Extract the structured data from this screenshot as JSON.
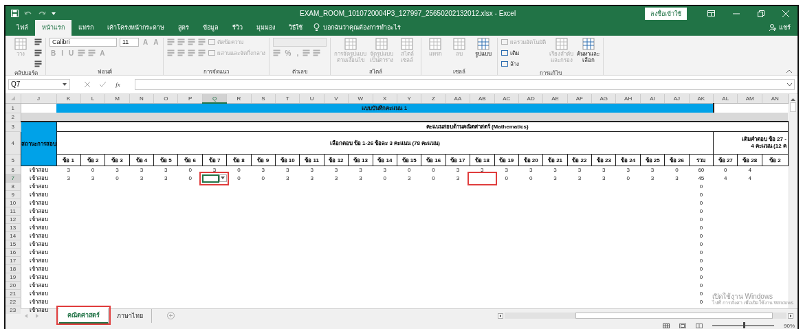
{
  "title_bar": {
    "title": "EXAM_ROOM_1010720004P3_127997_25650202132012.xlsx  -  Excel",
    "sign_in": "ลงชื่อเข้าใช้"
  },
  "ribbon_tabs": [
    {
      "label": "ไฟล์",
      "selected": false
    },
    {
      "label": "หน้าแรก",
      "selected": true
    },
    {
      "label": "แทรก",
      "selected": false
    },
    {
      "label": "เค้าโครงหน้ากระดาษ",
      "selected": false
    },
    {
      "label": "สูตร",
      "selected": false
    },
    {
      "label": "ข้อมูล",
      "selected": false
    },
    {
      "label": "รีวิว",
      "selected": false
    },
    {
      "label": "มุมมอง",
      "selected": false
    },
    {
      "label": "วิธีใช้",
      "selected": false
    }
  ],
  "tell_me": {
    "placeholder": "บอกฉันว่าคุณต้องการทำอะไร"
  },
  "share": "แชร์",
  "ribbon_groups": [
    {
      "label": "คลิปบอร์ด",
      "parts": [
        {
          "kind": "large",
          "items": [
            {
              "kind": "large",
              "label": "วาง",
              "disabled": true
            }
          ]
        },
        {
          "kind": "lines",
          "items": [
            [
              {
                "kind": "icon",
                "disabled": false
              }
            ],
            [
              {
                "kind": "icon",
                "disabled": false
              }
            ],
            [
              {
                "kind": "icon",
                "disabled": false
              }
            ]
          ]
        }
      ]
    },
    {
      "label": "ฟอนต์",
      "parts": [
        {
          "kind": "lines",
          "items": [
            [
              {
                "kind": "field",
                "label": "Calibri",
                "disabled": false
              },
              {
                "kind": "field",
                "label": "11",
                "disabled": false
              },
              {
                "kind": "glyph",
                "label": "A",
                "disabled": true
              },
              {
                "kind": "glyph",
                "label": "A",
                "disabled": true
              }
            ],
            [
              {
                "kind": "glyph",
                "label": "B",
                "disabled": true
              },
              {
                "kind": "glyph",
                "label": "I",
                "disabled": true
              },
              {
                "kind": "glyph",
                "label": "U",
                "disabled": true
              },
              {
                "kind": "icon",
                "disabled": true
              },
              {
                "kind": "icon",
                "disabled": true
              },
              {
                "kind": "glyph",
                "label": "A",
                "disabled": true
              }
            ]
          ]
        }
      ]
    },
    {
      "label": "การจัดแนว",
      "parts": [
        {
          "kind": "lines",
          "items": [
            [
              {
                "kind": "icon",
                "disabled": true
              },
              {
                "kind": "icon",
                "disabled": true
              },
              {
                "kind": "icon",
                "disabled": true
              },
              {
                "kind": "icon",
                "disabled": true
              },
              {
                "kind": "small",
                "label": "ตัดข้อความ",
                "disabled": true
              }
            ],
            [
              {
                "kind": "icon",
                "disabled": true
              },
              {
                "kind": "icon",
                "disabled": true
              },
              {
                "kind": "icon",
                "disabled": true
              },
              {
                "kind": "icon",
                "disabled": true
              },
              {
                "kind": "small",
                "label": "ผสานและจัดกึ่งกลาง",
                "disabled": true
              }
            ]
          ]
        }
      ]
    },
    {
      "label": "ตัวเลข",
      "parts": [
        {
          "kind": "lines",
          "items": [
            [
              {
                "kind": "field",
                "disabled": true
              }
            ],
            [
              {
                "kind": "icon",
                "disabled": true
              },
              {
                "kind": "glyph",
                "label": "%",
                "disabled": true
              },
              {
                "kind": "glyph",
                "label": ",",
                "disabled": true
              },
              {
                "kind": "icon",
                "disabled": true
              },
              {
                "kind": "icon",
                "disabled": true
              }
            ]
          ]
        }
      ]
    },
    {
      "label": "สไตล์",
      "parts": [
        {
          "kind": "large",
          "items": [
            {
              "kind": "large",
              "label": "การจัดรูปแบบ\nตามเงื่อนไข",
              "disabled": true
            },
            {
              "kind": "large",
              "label": "จัดรูปแบบ\nเป็นตาราง",
              "disabled": true
            },
            {
              "kind": "large",
              "label": "สไตล์\nเซลล์",
              "disabled": true
            }
          ]
        }
      ]
    },
    {
      "label": "เซลล์",
      "parts": [
        {
          "kind": "large",
          "items": [
            {
              "kind": "large",
              "label": "แทรก",
              "disabled": true
            },
            {
              "kind": "large",
              "label": "ลบ",
              "disabled": true
            },
            {
              "kind": "large",
              "label": "รูปแบบ",
              "disabled": false
            }
          ]
        }
      ]
    },
    {
      "label": "การแก้ไข",
      "parts": [
        {
          "kind": "lines",
          "items": [
            [
              {
                "kind": "small",
                "label": "ผลรวมอัตโนมัติ",
                "disabled": true
              }
            ],
            [
              {
                "kind": "small",
                "label": "เติม",
                "disabled": false
              }
            ],
            [
              {
                "kind": "small",
                "label": "ล้าง",
                "disabled": false
              }
            ]
          ]
        },
        {
          "kind": "large",
          "items": [
            {
              "kind": "large",
              "label": "เรียงลำดับ\nและกรอง",
              "disabled": true
            },
            {
              "kind": "large",
              "label": "ค้นหาและ\nเลือก",
              "disabled": false
            }
          ]
        }
      ]
    }
  ],
  "formula_bar": {
    "name_box": "Q7",
    "function_label": "fx"
  },
  "columns": [
    {
      "label": "J",
      "selected": false
    },
    {
      "label": "K",
      "selected": false
    },
    {
      "label": "L",
      "selected": false
    },
    {
      "label": "M",
      "selected": false
    },
    {
      "label": "N",
      "selected": false
    },
    {
      "label": "O",
      "selected": false
    },
    {
      "label": "P",
      "selected": false
    },
    {
      "label": "Q",
      "selected": true
    },
    {
      "label": "R",
      "selected": false
    },
    {
      "label": "S",
      "selected": false
    },
    {
      "label": "T",
      "selected": false
    },
    {
      "label": "U",
      "selected": false
    },
    {
      "label": "V",
      "selected": false
    },
    {
      "label": "W",
      "selected": false
    },
    {
      "label": "X",
      "selected": false
    },
    {
      "label": "Y",
      "selected": false
    },
    {
      "label": "Z",
      "selected": false
    },
    {
      "label": "AA",
      "selected": false
    },
    {
      "label": "AB",
      "selected": false
    },
    {
      "label": "AC",
      "selected": false
    },
    {
      "label": "AD",
      "selected": false
    },
    {
      "label": "AE",
      "selected": false
    },
    {
      "label": "AF",
      "selected": false
    },
    {
      "label": "AG",
      "selected": false
    },
    {
      "label": "AH",
      "selected": false
    },
    {
      "label": "AI",
      "selected": false
    },
    {
      "label": "AJ",
      "selected": false
    },
    {
      "label": "AK",
      "selected": false
    },
    {
      "label": "AL",
      "selected": false
    },
    {
      "label": "AM",
      "selected": false
    },
    {
      "label": "AN",
      "selected": false
    }
  ],
  "header_rows": [
    "1",
    "2",
    "3",
    "4",
    "5"
  ],
  "sheet_header": {
    "banner": "แบบบันทึกคะแนน 1",
    "status_heading": "สถานะการสอบ",
    "section_title": "คะแนนสอบด้านคณิตศาสตร์ (Mathematics)",
    "choice_heading": "เลือกตอบ ข้อ 1-26 ข้อละ 3 คะแนน (78 คะแนน)",
    "fill_heading": [
      "เติมคำตอบ ข้อ 27 -",
      "4 คะแนน (12 ค"
    ],
    "question_labels": [
      "ข้อ 1",
      "ข้อ 2",
      "ข้อ 3",
      "ข้อ 4",
      "ข้อ 5",
      "ข้อ 6",
      "ข้อ 7",
      "ข้อ 8",
      "ข้อ 9",
      "ข้อ 10",
      "ข้อ 11",
      "ข้อ 12",
      "ข้อ 13",
      "ข้อ 14",
      "ข้อ 15",
      "ข้อ 16",
      "ข้อ 17",
      "ข้อ 18",
      "ข้อ 19",
      "ข้อ 20",
      "ข้อ 21",
      "ข้อ 22",
      "ข้อ 23",
      "ข้อ 24",
      "ข้อ 25",
      "ข้อ 26"
    ],
    "total_label": "รวม",
    "fill_labels": [
      "ข้อ 27",
      "ข้อ 28",
      "ข้อ 2"
    ]
  },
  "rows": [
    {
      "num": "6",
      "selected": false,
      "status": "เข้าสอบ",
      "scores": [
        "3",
        "0",
        "3",
        "3",
        "3",
        "0",
        "3",
        "0",
        "3",
        "3",
        "3",
        "3",
        "3",
        "3",
        "0",
        "0",
        "3",
        "3",
        "3",
        "3",
        "3",
        "3",
        "3",
        "3",
        "3",
        "0"
      ],
      "total": "60",
      "extra": [
        "0",
        "4"
      ]
    },
    {
      "num": "7",
      "selected": true,
      "status": "เข้าสอบ",
      "scores": [
        "3",
        "3",
        "0",
        "3",
        "3",
        "0",
        {
          "selected": true,
          "marked": true,
          "dropdown": true
        },
        "0",
        "0",
        "3",
        "3",
        "3",
        "3",
        "0",
        "3",
        "0",
        "3",
        {
          "marked": true
        },
        "0",
        "0",
        "3",
        "3",
        "3",
        "0",
        "3",
        "3"
      ],
      "total": "45",
      "extra": [
        "4",
        "4"
      ]
    },
    {
      "num": "8",
      "selected": false,
      "status": "เข้าสอบ",
      "total": "0"
    },
    {
      "num": "9",
      "selected": false,
      "status": "เข้าสอบ",
      "total": "0"
    },
    {
      "num": "10",
      "selected": false,
      "status": "เข้าสอบ",
      "total": "0"
    },
    {
      "num": "11",
      "selected": false,
      "status": "เข้าสอบ",
      "total": "0"
    },
    {
      "num": "12",
      "selected": false,
      "status": "เข้าสอบ",
      "total": "0"
    },
    {
      "num": "13",
      "selected": false,
      "status": "เข้าสอบ",
      "total": "0"
    },
    {
      "num": "14",
      "selected": false,
      "status": "เข้าสอบ",
      "total": "0"
    },
    {
      "num": "15",
      "selected": false,
      "status": "เข้าสอบ",
      "total": "0"
    },
    {
      "num": "16",
      "selected": false,
      "status": "เข้าสอบ",
      "total": "0"
    },
    {
      "num": "17",
      "selected": false,
      "status": "เข้าสอบ",
      "total": "0"
    },
    {
      "num": "18",
      "selected": false,
      "status": "เข้าสอบ",
      "total": "0"
    },
    {
      "num": "19",
      "selected": false,
      "status": "เข้าสอบ",
      "total": "0"
    },
    {
      "num": "20",
      "selected": false,
      "status": "เข้าสอบ",
      "total": "0"
    },
    {
      "num": "21",
      "selected": false,
      "status": "เข้าสอบ",
      "total": "0"
    },
    {
      "num": "22",
      "selected": false,
      "status": "เข้าสอบ",
      "total": "0"
    },
    {
      "num": "23",
      "selected": false,
      "status": "เข้าสอบ"
    }
  ],
  "sheet_tabs": [
    {
      "label": "คณิตศาสตร์",
      "selected": true,
      "marked": true
    },
    {
      "label": "ภาษาไทย",
      "selected": false,
      "marked": false
    }
  ],
  "activation_notice": [
    "เปิดใช้งาน Windows",
    "ไปที่ การตั้งค่า เพื่อเปิดใช้งาน Windows"
  ],
  "zoom": {
    "level": 0.5,
    "reading": "90%"
  }
}
